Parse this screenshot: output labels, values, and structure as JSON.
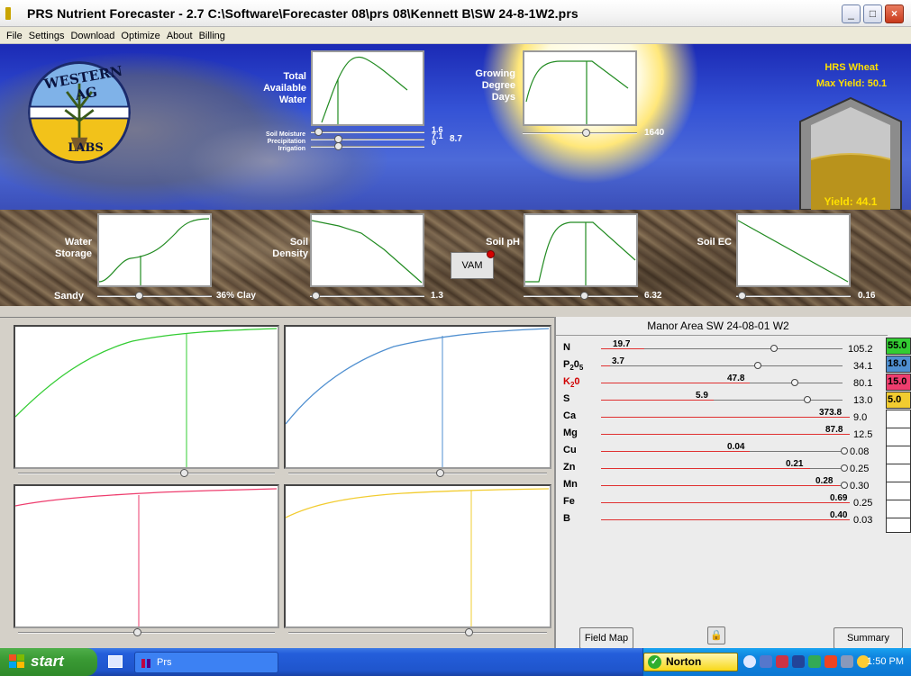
{
  "window": {
    "title": "PRS Nutrient Forecaster - 2.7 C:\\Software\\Forecaster 08\\prs 08\\Kennett B\\SW 24-8-1W2.prs",
    "controls": [
      "_",
      "□",
      "×"
    ]
  },
  "menu": [
    "File",
    "Settings",
    "Download",
    "Optimize",
    "About",
    "Billing"
  ],
  "logo": {
    "top_text": "WESTERN AG",
    "bottom_text": "LABS"
  },
  "top_graphs": {
    "water": {
      "label_lines": [
        "Total",
        "Available",
        "Water"
      ],
      "slider_labels": [
        "Soil Moisture",
        "Precipitation",
        "Irrigation"
      ],
      "values": [
        "1.6",
        "7.1",
        "0"
      ],
      "total": "8.7"
    },
    "gdd": {
      "label_lines": [
        "Growing",
        "Degree",
        "Days"
      ],
      "value": "1640"
    }
  },
  "crop_info": {
    "name": "HRS Wheat",
    "max_yield_label": "Max Yield: 50.1",
    "yield_label": "Yield: 44.1"
  },
  "soil_graphs": {
    "water_storage": {
      "label_lines": [
        "Water",
        "Storage"
      ],
      "left": "Sandy",
      "right": "36% Clay"
    },
    "soil_density": {
      "label_lines": [
        "Soil",
        "Density"
      ],
      "value": "1.3"
    },
    "soil_ph": {
      "label": "Soil pH",
      "value": "6.32"
    },
    "soil_ec": {
      "label": "Soil EC",
      "value": "0.16"
    },
    "vam_label": "VAM"
  },
  "nutrients": {
    "header": "Manor Area SW 24-08-01 W2",
    "rows": [
      {
        "name": "N",
        "value": "19.7",
        "max": "105.2"
      },
      {
        "name": "P205",
        "value": "3.7",
        "max": "34.1"
      },
      {
        "name": "K20",
        "value": "47.8",
        "max": "80.1"
      },
      {
        "name": "S",
        "value": "5.9",
        "max": "13.0"
      },
      {
        "name": "Ca",
        "value": "373.8",
        "max": "9.0"
      },
      {
        "name": "Mg",
        "value": "87.8",
        "max": "12.5"
      },
      {
        "name": "Cu",
        "value": "0.04",
        "max": "0.08"
      },
      {
        "name": "Zn",
        "value": "0.21",
        "max": "0.25"
      },
      {
        "name": "Mn",
        "value": "0.28",
        "max": "0.30"
      },
      {
        "name": "Fe",
        "value": "0.69",
        "max": "0.25"
      },
      {
        "name": "B",
        "value": "0.40",
        "max": "0.03"
      }
    ],
    "swatches": [
      {
        "value": "55.0",
        "color": "#33cc33"
      },
      {
        "value": "18.0",
        "color": "#4f8fd0"
      },
      {
        "value": "15.0",
        "color": "#ee3d6e"
      },
      {
        "value": "5.0",
        "color": "#f2cc30"
      }
    ],
    "field_map_label": "Field Map",
    "summary_label": "Summary"
  },
  "taskbar": {
    "start_label": "start",
    "app_label": "Prs",
    "norton_label": "Norton",
    "clock": "1:50 PM"
  }
}
